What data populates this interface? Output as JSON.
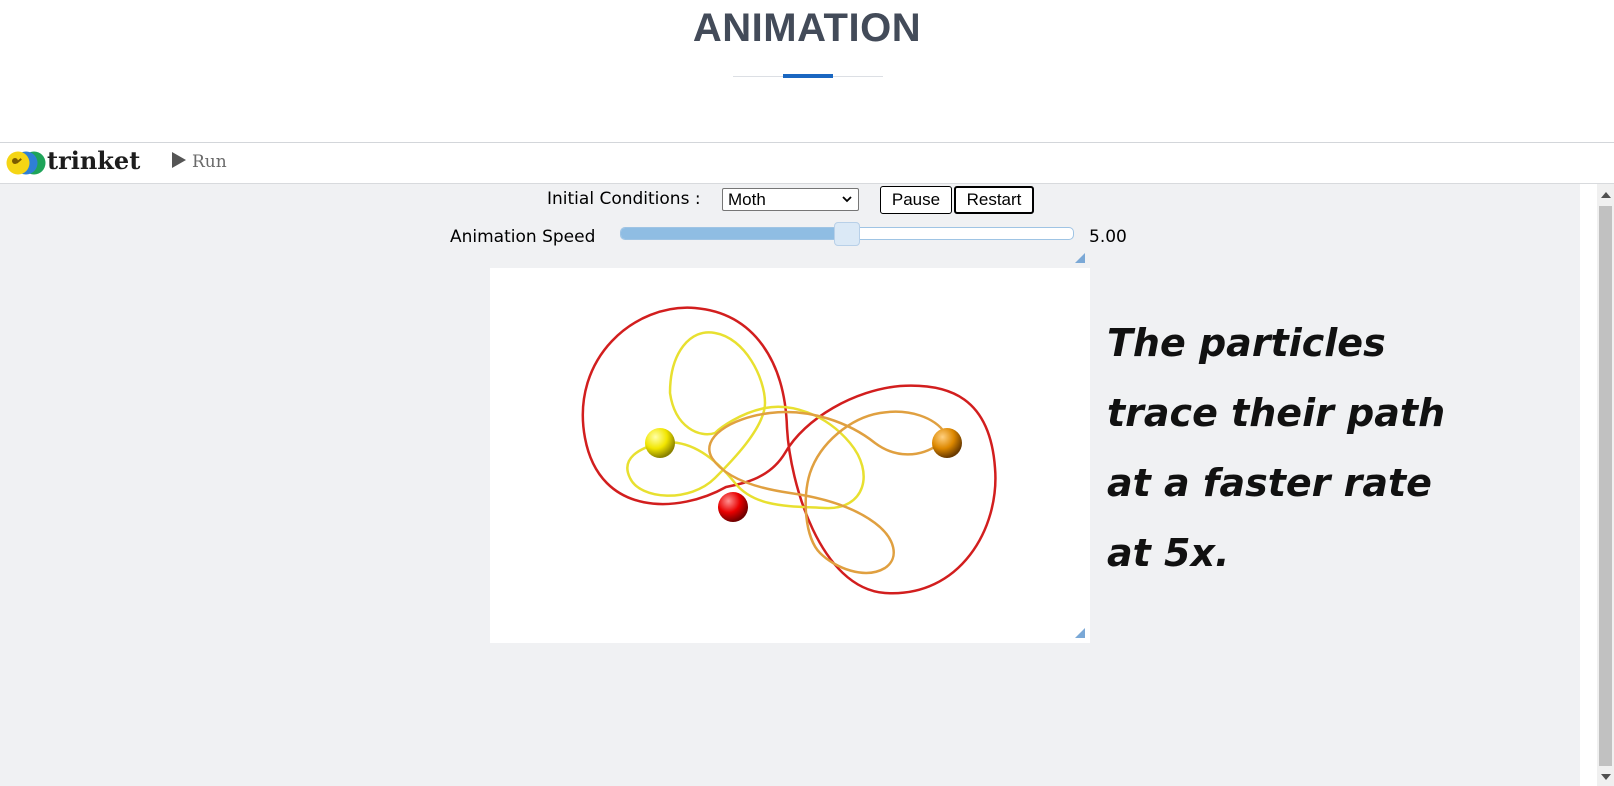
{
  "page": {
    "title": "ANIMATION"
  },
  "toolbar": {
    "brand": "trinket",
    "run_label": "Run"
  },
  "controls": {
    "initial_conditions_label": "Initial Conditions :",
    "initial_conditions_value": "Moth",
    "pause_label": "Pause",
    "restart_label": "Restart",
    "speed_label": "Animation Speed",
    "speed_value": "5.00",
    "speed_fraction": 0.5
  },
  "canvas": {
    "particles": [
      {
        "name": "yellow",
        "color": "#ffee00"
      },
      {
        "name": "red",
        "color": "#ee1111"
      },
      {
        "name": "orange",
        "color": "#e08a00"
      }
    ],
    "path_colors": {
      "red": "#d21e1e",
      "yellow": "#e8e030",
      "orange": "#e0a040"
    }
  },
  "caption": {
    "lines": [
      "The particles",
      "trace their path",
      "at a faster rate",
      "at 5x."
    ]
  }
}
